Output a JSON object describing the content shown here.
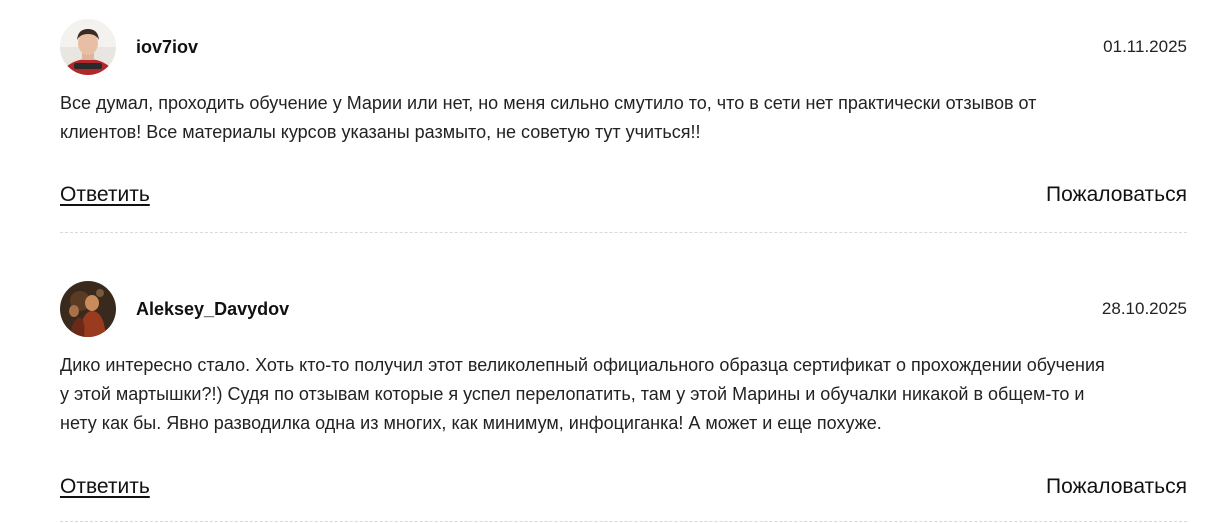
{
  "comments": [
    {
      "username": "iov7iov",
      "date": "01.11.2025",
      "text": "Все думал, проходить обучение у Марии или нет, но меня сильно смутило то, что в сети нет практически отзывов от\nклиентов! Все материалы курсов указаны размыто, не советую тут учиться!!",
      "reply_label": "Ответить",
      "report_label": "Пожаловаться",
      "avatar_icon": "avatar-photo-person"
    },
    {
      "username": "Aleksey_Davydov",
      "date": "28.10.2025",
      "text": "Дико интересно стало. Хоть кто-то получил этот великолепный официального образца сертификат о прохождении обучения\nу этой мартышки?!) Судя по отзывам которые я успел перелопатить, там у этой Марины и обучалки никакой в общем-то и\nнету как бы. Явно разводилка одна из многих, как минимум, инфоциганка! А может и еще похуже.",
      "reply_label": "Ответить",
      "report_label": "Пожаловаться",
      "avatar_icon": "avatar-photo-painting"
    }
  ],
  "colors": {
    "text": "#1a1a1a",
    "divider": "#d9d9d9",
    "background": "#ffffff"
  }
}
